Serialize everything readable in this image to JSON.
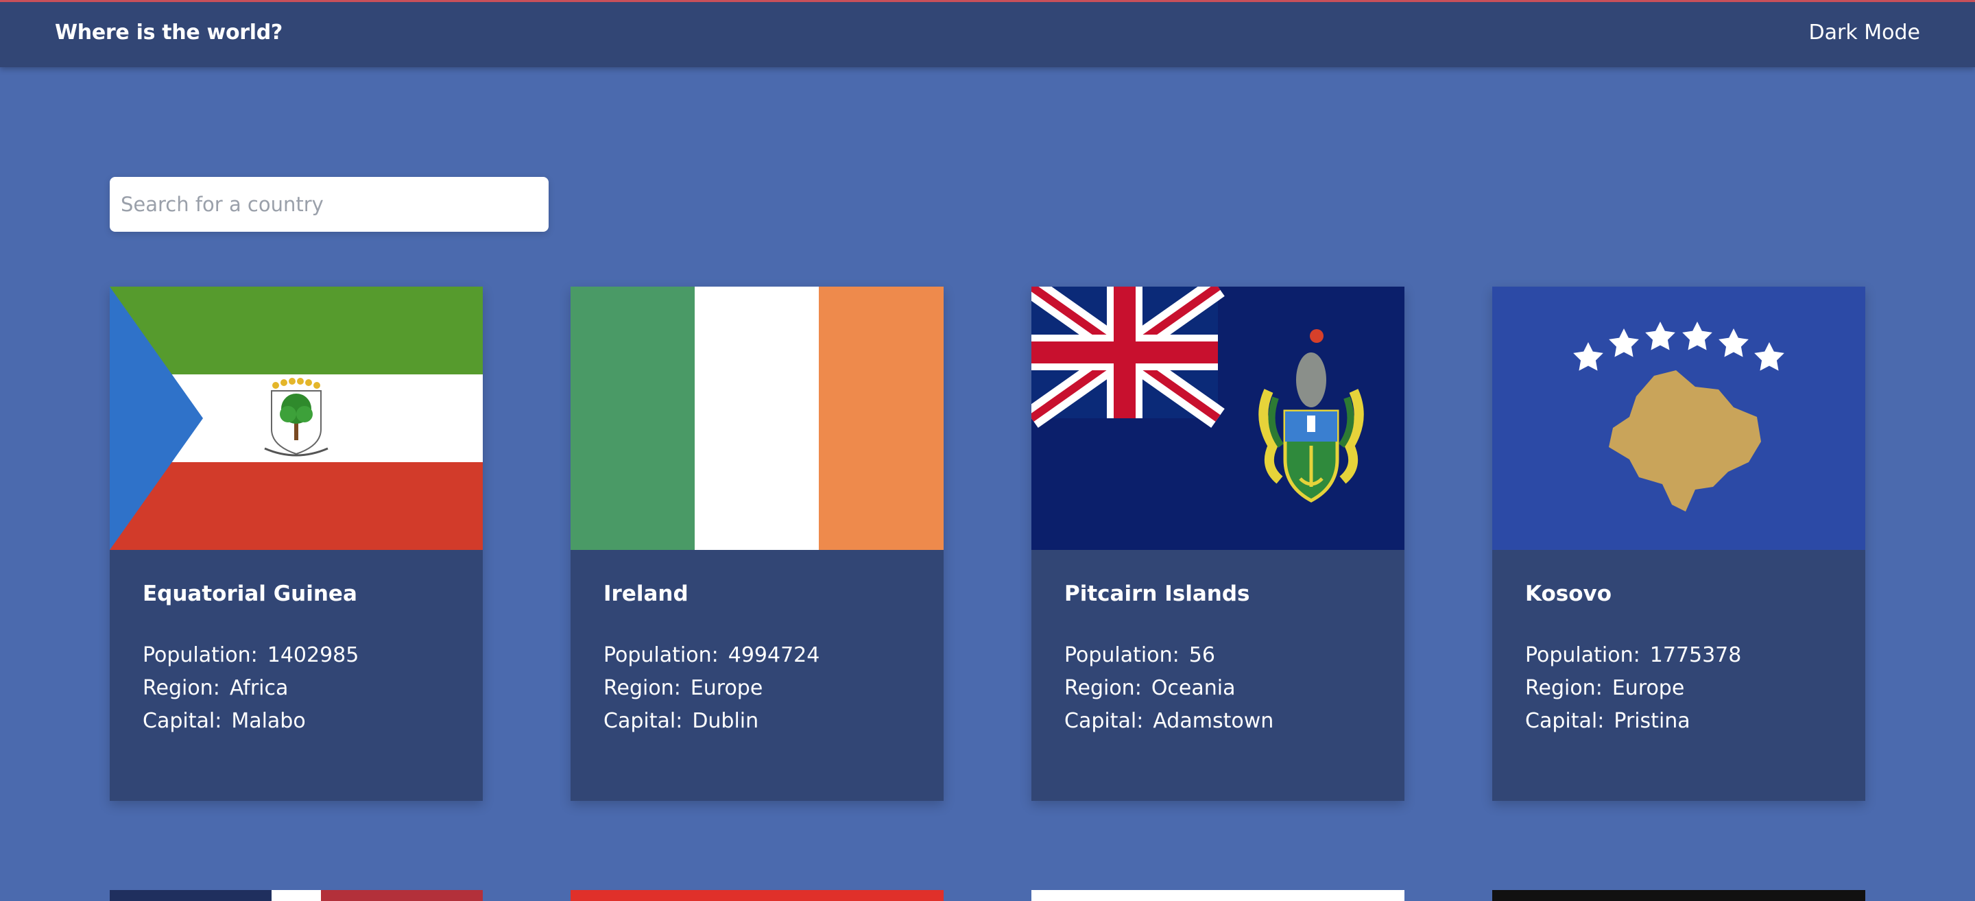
{
  "header": {
    "title": "Where is the world?",
    "dark_mode_label": "Dark Mode"
  },
  "search": {
    "placeholder": "Search for a country",
    "value": ""
  },
  "labels": {
    "population": "Population:",
    "region": "Region:",
    "capital": "Capital:"
  },
  "countries": [
    {
      "name": "Equatorial Guinea",
      "population": "1402985",
      "region": "Africa",
      "capital": "Malabo",
      "flag_icon": "equatorial-guinea-flag"
    },
    {
      "name": "Ireland",
      "population": "4994724",
      "region": "Europe",
      "capital": "Dublin",
      "flag_icon": "ireland-flag"
    },
    {
      "name": "Pitcairn Islands",
      "population": "56",
      "region": "Oceania",
      "capital": "Adamstown",
      "flag_icon": "pitcairn-islands-flag"
    },
    {
      "name": "Kosovo",
      "population": "1775378",
      "region": "Europe",
      "capital": "Pristina",
      "flag_icon": "kosovo-flag"
    }
  ],
  "colors": {
    "background": "#4b6aae",
    "header": "#324675",
    "card": "#324675",
    "text": "#ffffff"
  }
}
